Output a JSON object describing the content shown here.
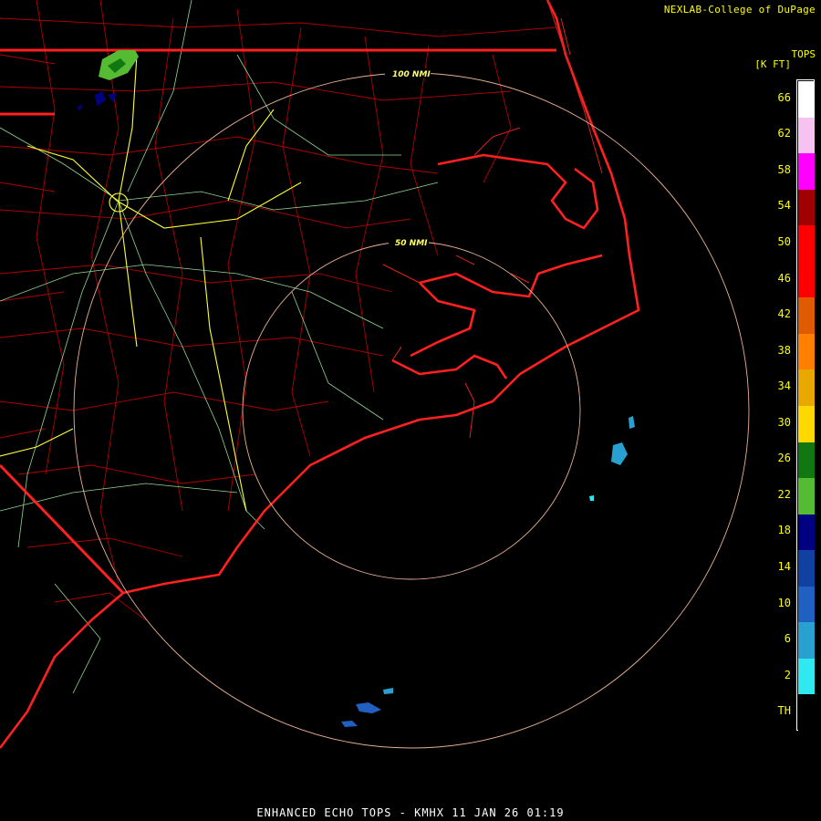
{
  "credit": "NEXLAB-College of DuPage",
  "product_title": "ENHANCED ECHO TOPS - KMHX 11 JAN 26 01:19",
  "legend": {
    "title_line1": "TOPS",
    "title_line2": "[K FT]",
    "entries": [
      {
        "label": "66",
        "color": "#ffffff"
      },
      {
        "label": "62",
        "color": "#f6c3f0"
      },
      {
        "label": "58",
        "color": "#ff00ff"
      },
      {
        "label": "54",
        "color": "#a00000"
      },
      {
        "label": "50",
        "color": "#ff0000"
      },
      {
        "label": "46",
        "color": "#ff0000"
      },
      {
        "label": "42",
        "color": "#e05a00"
      },
      {
        "label": "38",
        "color": "#ff8000"
      },
      {
        "label": "34",
        "color": "#e8a800"
      },
      {
        "label": "30",
        "color": "#ffd800"
      },
      {
        "label": "26",
        "color": "#117711"
      },
      {
        "label": "22",
        "color": "#55bb33"
      },
      {
        "label": "18",
        "color": "#000080"
      },
      {
        "label": "14",
        "color": "#1040a0"
      },
      {
        "label": "10",
        "color": "#2060c0"
      },
      {
        "label": "6",
        "color": "#28a0d0"
      },
      {
        "label": "2",
        "color": "#30e8f0"
      },
      {
        "label": "TH",
        "color": "#000000"
      }
    ]
  },
  "range_rings": {
    "inner_label": "50 NMI",
    "outer_label": "100 NMI",
    "color": "#e8b090"
  },
  "map_colors": {
    "state_borders": "#ff2020",
    "county_lines": "#c00000",
    "interstates": "#ffff33",
    "highways": "#aaffaa"
  }
}
